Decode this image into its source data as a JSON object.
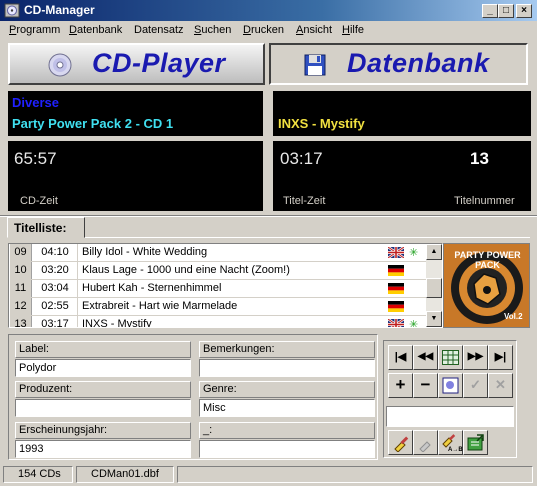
{
  "window": {
    "title": "CD-Manager"
  },
  "menu": [
    {
      "label": "Programm",
      "u": "P",
      "rest": "rogramm"
    },
    {
      "label": "Datenbank",
      "u": "D",
      "rest": "atenbank"
    },
    {
      "label": "Datensatz",
      "u": "",
      "rest": "Datensatz"
    },
    {
      "label": "Suchen",
      "u": "S",
      "rest": "uchen"
    },
    {
      "label": "Drucken",
      "u": "D",
      "rest": "rucken"
    },
    {
      "label": "Ansicht",
      "u": "A",
      "rest": "nsicht"
    },
    {
      "label": "Hilfe",
      "u": "H",
      "rest": "ilfe"
    }
  ],
  "modes": {
    "player": "CD-Player",
    "database": "Datenbank"
  },
  "display": {
    "artist": "Diverse",
    "album": "Party Power Pack 2 - CD 1",
    "track_title": "INXS - Mystify",
    "cd_time": "65:57",
    "title_time": "03:17",
    "track_number": "13",
    "cd_time_label": "CD-Zeit",
    "title_time_label": "Titel-Zeit",
    "track_number_label": "Titelnummer"
  },
  "tracklist": {
    "tab_label": "Titelliste:",
    "rows": [
      {
        "nr": "09",
        "time": "04:10",
        "title": "Billy Idol - White Wedding",
        "flag": "uk",
        "star": true
      },
      {
        "nr": "10",
        "time": "03:20",
        "title": "Klaus Lage - 1000 und eine Nacht (Zoom!)",
        "flag": "de",
        "star": false
      },
      {
        "nr": "11",
        "time": "03:04",
        "title": "Hubert Kah - Sternenhimmel",
        "flag": "de",
        "star": false
      },
      {
        "nr": "12",
        "time": "02:55",
        "title": "Extrabreit - Hart wie Marmelade",
        "flag": "de",
        "star": false
      },
      {
        "nr": "13",
        "time": "03:17",
        "title": "INXS - Mystify",
        "flag": "uk",
        "star": true
      }
    ]
  },
  "cover": {
    "text": "PARTY POWER PACK",
    "vol": "Vol.2"
  },
  "fields": {
    "label_caption": "Label:",
    "label_value": "Polydor",
    "remarks_caption": "Bemerkungen:",
    "remarks_value": "",
    "producer_caption": "Produzent:",
    "producer_value": "",
    "genre_caption": "Genre:",
    "genre_value": "Misc",
    "year_caption": "Erscheinungsjahr:",
    "year_value": "1993",
    "extra_caption": "_:",
    "extra_value": ""
  },
  "tools": {
    "first": "|◀",
    "prev": "◀◀",
    "next": "▶▶",
    "last": "▶|",
    "add": "+",
    "remove": "−",
    "confirm": "✓",
    "cancel": "✕",
    "ab_label": "A→B",
    "search_value": ""
  },
  "status": {
    "count": "154 CDs",
    "file": "CDMan01.dbf"
  },
  "colors": {
    "artist": "#2020ff",
    "album": "#40e0f0",
    "track": "#f0e040",
    "mode_label": "#1a1ab0"
  }
}
